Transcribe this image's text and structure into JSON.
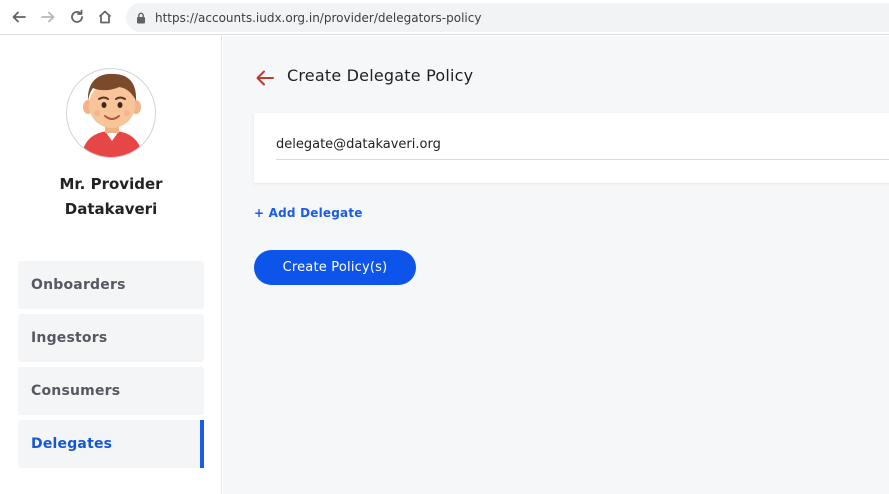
{
  "browser": {
    "url": "https://accounts.iudx.org.in/provider/delegators-policy",
    "icons": [
      "back-arrow-icon",
      "forward-arrow-icon",
      "reload-icon",
      "home-icon",
      "lock-icon"
    ]
  },
  "sidebar": {
    "user_name_line1": "Mr. Provider",
    "user_name_line2": "Datakaveri",
    "items": [
      {
        "label": "Onboarders",
        "active": false
      },
      {
        "label": "Ingestors",
        "active": false
      },
      {
        "label": "Consumers",
        "active": false
      },
      {
        "label": "Delegates",
        "active": true
      }
    ]
  },
  "main": {
    "title": "Create Delegate Policy",
    "email_value": "delegate@datakaveri.org",
    "add_delegate_label": "+ Add Delegate",
    "create_button_label": "Create Policy(s)"
  },
  "colors": {
    "accent": "#0d55ea",
    "back_arrow": "#c0392b",
    "active_nav": "#1457d6"
  }
}
